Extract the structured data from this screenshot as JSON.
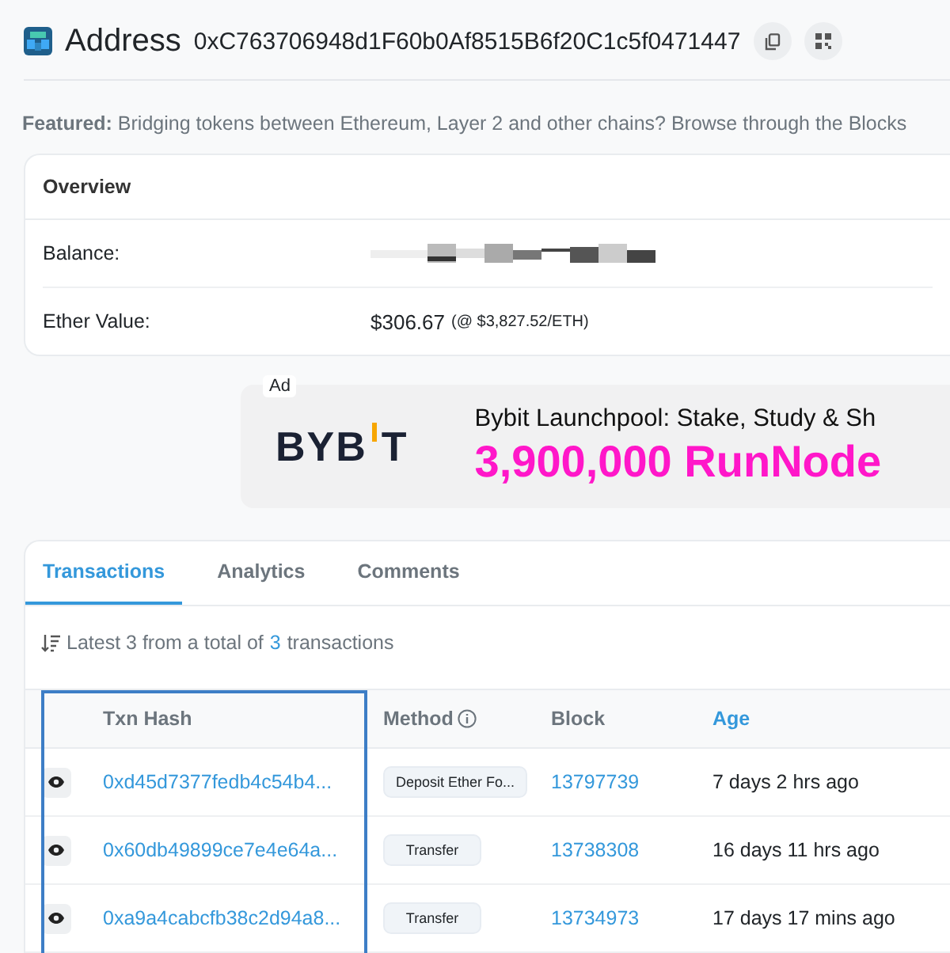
{
  "header": {
    "title": "Address",
    "address": "0xC763706948d1F60b0Af8515B6f20C1c5f0471447"
  },
  "featured": "**Featured:** Bridging tokens between Ethereum, Layer 2 and other chains? Browse through the Blocks",
  "overview": {
    "title": "Overview",
    "rows": [
      {
        "label": "Balance:",
        "kind": "redacted"
      },
      {
        "label": "Ether Value:",
        "kind": "value",
        "value": "$306.67",
        "note": "(@ $3,827.52/ETH)"
      }
    ]
  },
  "ad": {
    "badge": "Ad",
    "logo": "BYB",
    "logo_end": "T",
    "headline": "Bybit Launchpool: Stake, Study & Sh",
    "amount": "3,900,000 RunNode"
  },
  "tabs": [
    {
      "label": "Transactions",
      "selected": true
    },
    {
      "label": "Analytics",
      "selected": false
    },
    {
      "label": "Comments",
      "selected": false
    }
  ],
  "summary": {
    "prefix": "Latest 3 from a total of",
    "count": "3",
    "suffix": "transactions"
  },
  "table": {
    "columns": [
      {
        "label": "Txn Hash",
        "kind": "plain",
        "highlighted": true
      },
      {
        "label": "Method",
        "kind": "info",
        "highlighted": false
      },
      {
        "label": "Block",
        "kind": "plain",
        "highlighted": false
      },
      {
        "label": "Age",
        "kind": "link",
        "highlighted": false
      }
    ],
    "rows": [
      {
        "hash": "0xd45d7377fedb4c54b4...",
        "method": "Deposit Ether Fo...",
        "block": "13797739",
        "age": "7 days 2 hrs ago"
      },
      {
        "hash": "0x60db49899ce7e4e64a...",
        "method": "Transfer",
        "block": "13738308",
        "age": "16 days 11 hrs ago"
      },
      {
        "hash": "0xa9a4cabcfb38c2d94a8...",
        "method": "Transfer",
        "block": "13734973",
        "age": "17 days 17 mins ago"
      }
    ]
  }
}
